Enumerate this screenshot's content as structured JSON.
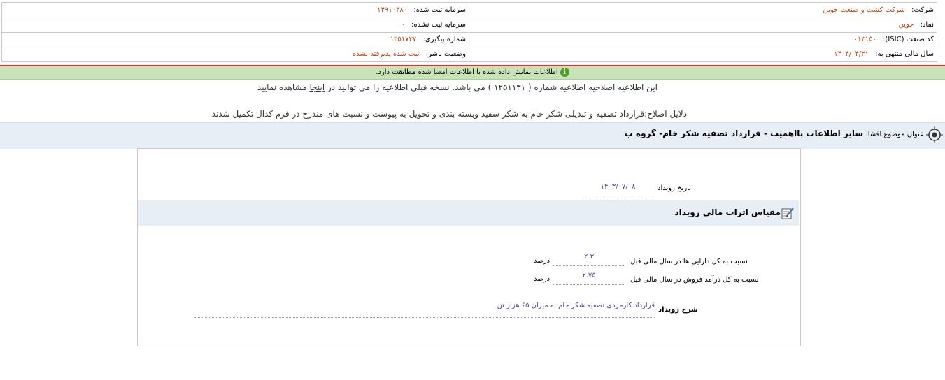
{
  "company": {
    "company_label": "شرکت:",
    "company_value": "شرکت کشت و صنعت جوین",
    "symbol_label": "نماد:",
    "symbol_value": "جوین",
    "isic_label": "کد صنعت (ISIC):",
    "isic_value": "۰۱۳۱۵۰",
    "fiscal_label": "سال مالی منتهی به:",
    "fiscal_value": "۱۴۰۴/۰۴/۳۱",
    "reg_capital_label": "سرمایه ثبت شده:",
    "reg_capital_value": "۱۴۹۱۰۴۸۰",
    "unreg_capital_label": "سرمایه ثبت نشده:",
    "unreg_capital_value": "۰",
    "tracking_label": "شماره پیگیری:",
    "tracking_value": "۱۳۵۱۷۳۷",
    "publisher_status_label": "وضعیت ناشر:",
    "publisher_status_value": "ثبت شده پذیرفته نشده"
  },
  "alert": {
    "icon": "info-icon",
    "text": "اطلاعات نمایش داده شده با اطلاعات امضا شده مطابقت دارد."
  },
  "notes": {
    "correction_before": "این اطلاعیه اصلاحیه اطلاعیه شماره ( ۱۲۵۱۱۳۱ ) می باشد. نسخه قبلی اطلاعیه را می توانید در",
    "correction_link": "اینجا",
    "correction_after": "مشاهده نمایید",
    "reasons": "دلایل اصلاح:قرارداد تصفیه و تبدیلی شکر خام به شکر سفید وبسته بندی و تحویل به پیوست و نسبت های مندرج در فرم کدال تکمیل شدند"
  },
  "subject": {
    "label": "عنوان موضوع افشا:",
    "value": "سایر اطلاعات بااهمیت - قرارداد تصفیه شکر خام- گروه ب",
    "icon": "target-icon"
  },
  "event": {
    "date_label": "تاریخ رویداد",
    "date_value": "۱۴۰۳/۰۷/۰۸"
  },
  "section": {
    "title": "مقیاس اثرات مالی رویداد",
    "icon": "edit-form-icon"
  },
  "ratios": [
    {
      "label": "نسبت به کل دارایی ها در سال مالی قبل",
      "value": "۲.۳",
      "unit": "درصد"
    },
    {
      "label": "نسبت به کل درآمد فروش در سال مالی قبل",
      "value": "۲.۷۵",
      "unit": "درصد"
    }
  ],
  "description": {
    "label": "شرح رویداد",
    "value": "قرارداد کارمزدی تصفیه شکر خام به میزان ۶۵ هزار تن"
  },
  "colors": {
    "value_text": "#b5461a",
    "alert_bg": "#c8e3b8",
    "alert_icon": "#4a9e1e",
    "top_rule": "#e4322d",
    "section_bg": "#e8eef6",
    "field_value": "#4a4a8a"
  }
}
